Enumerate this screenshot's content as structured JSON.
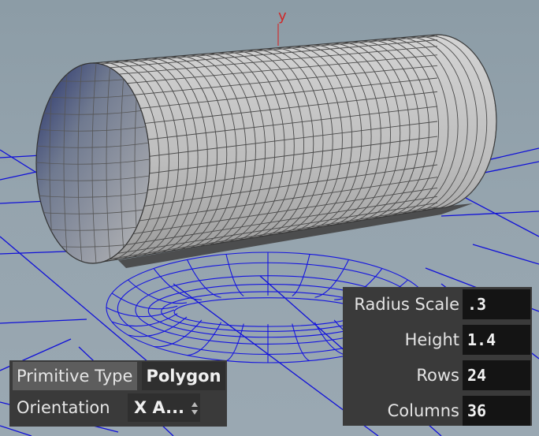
{
  "viewport": {
    "axis_label": "y",
    "background_colors": [
      "#8c9ca6",
      "#9aa8b2"
    ],
    "grid_color": "#1010d8",
    "cylinder_color": "#c2c2c2",
    "wireframe_color": "#1414e0"
  },
  "primitive_panel": {
    "primitive_type_label": "Primitive Type",
    "primitive_type_value": "Polygon",
    "orientation_label": "Orientation",
    "orientation_value": "X A..."
  },
  "params": [
    {
      "label": "Radius Scale",
      "value": ".3"
    },
    {
      "label": "Height",
      "value": "1.4"
    },
    {
      "label": "Rows",
      "value": "24"
    },
    {
      "label": "Columns",
      "value": "36"
    }
  ]
}
